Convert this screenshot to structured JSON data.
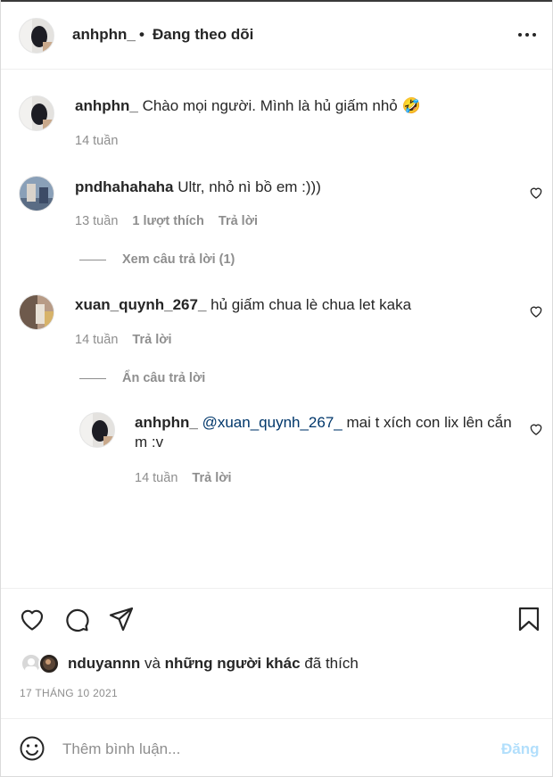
{
  "header": {
    "username": "anhphn_",
    "separator": "•",
    "follow_status": "Đang theo dõi",
    "more_icon": "more-horizontal-icon"
  },
  "caption": {
    "username": "anhphn_",
    "text": "Chào mọi người. Mình là hủ giấm nhỏ 🤣",
    "time": "14 tuần"
  },
  "comments": [
    {
      "username": "pndhahahaha",
      "text": "Ultr, nhỏ nì bồ em :)))",
      "time": "13 tuần",
      "likes": "1 lượt thích",
      "reply": "Trả lời",
      "view_replies": "Xem câu trả lời (1)"
    },
    {
      "username": "xuan_quynh_267_",
      "text": "hủ giấm chua lè chua let kaka",
      "time": "14 tuần",
      "reply": "Trả lời",
      "hide_replies": "Ẩn câu trả lời",
      "replies": [
        {
          "username": "anhphn_",
          "mention": "@xuan_quynh_267_",
          "text": "mai t xích con lix lên cắn m :v",
          "time": "14 tuần",
          "reply": "Trả lời"
        }
      ]
    }
  ],
  "actions": {
    "icons": [
      "heart-icon",
      "comment-icon",
      "share-icon",
      "bookmark-icon"
    ]
  },
  "likes": {
    "first_user": "nduyannn",
    "and": "và",
    "others": "những người khác",
    "liked": "đã thích"
  },
  "post_date": "17 THÁNG 10 2021",
  "add_comment": {
    "placeholder": "Thêm bình luận...",
    "post_label": "Đăng",
    "post_color": "#b2dffc"
  },
  "colors": {
    "text": "#262626",
    "muted": "#8e8e8e",
    "mention": "#00376b"
  }
}
